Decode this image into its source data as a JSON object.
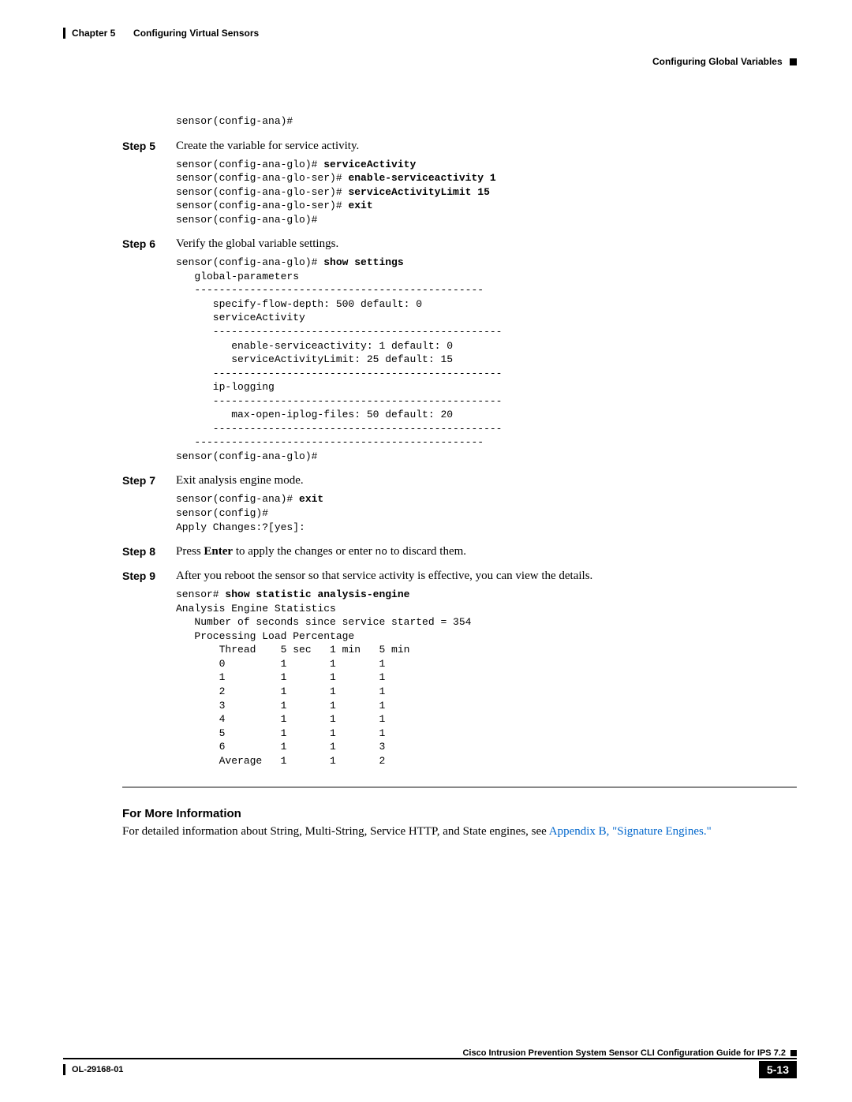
{
  "header": {
    "chapter": "Chapter 5",
    "chapterTitle": "Configuring Virtual Sensors",
    "section": "Configuring Global Variables"
  },
  "preCode0": "sensor(config-ana)#",
  "step5": {
    "label": "Step 5",
    "text": "Create the variable for service activity."
  },
  "code5a": "sensor(config-ana-glo)# ",
  "code5a_bold": "serviceActivity",
  "code5b": "sensor(config-ana-glo-ser)# ",
  "code5b_bold": "enable-serviceactivity 1",
  "code5c": "sensor(config-ana-glo-ser)# ",
  "code5c_bold": "serviceActivityLimit 15",
  "code5d": "sensor(config-ana-glo-ser)# ",
  "code5d_bold": "exit",
  "code5e": "sensor(config-ana-glo)#",
  "step6": {
    "label": "Step 6",
    "text": "Verify the global variable settings."
  },
  "code6a": "sensor(config-ana-glo)# ",
  "code6a_bold": "show settings",
  "code6b": "   global-parameters\n   -----------------------------------------------\n      specify-flow-depth: 500 default: 0\n      serviceActivity\n      -----------------------------------------------\n         enable-serviceactivity: 1 default: 0\n         serviceActivityLimit: 25 default: 15\n      -----------------------------------------------\n      ip-logging\n      -----------------------------------------------\n         max-open-iplog-files: 50 default: 20\n      -----------------------------------------------\n   -----------------------------------------------\nsensor(config-ana-glo)#",
  "step7": {
    "label": "Step 7",
    "text": "Exit analysis engine mode."
  },
  "code7a": "sensor(config-ana)# ",
  "code7a_bold": "exit",
  "code7b": "sensor(config)#\nApply Changes:?[yes]:",
  "step8": {
    "label": "Step 8",
    "textPre": "Press ",
    "textBold": "Enter",
    "textMid": " to apply the changes or enter ",
    "textMono": "no",
    "textPost": " to discard them."
  },
  "step9": {
    "label": "Step 9",
    "text": "After you reboot the sensor so that service activity is effective, you can view the details."
  },
  "code9a": "sensor# ",
  "code9a_bold": "show statistic analysis-engine",
  "code9b": "Analysis Engine Statistics\n   Number of seconds since service started = 354\n   Processing Load Percentage\n       Thread    5 sec   1 min   5 min\n       0         1       1       1\n       1         1       1       1\n       2         1       1       1\n       3         1       1       1\n       4         1       1       1\n       5         1       1       1\n       6         1       1       3\n       Average   1       1       2",
  "fmi": {
    "heading": "For More Information",
    "body": "For detailed information about String, Multi-String, Service HTTP, and State engines, see ",
    "link": "Appendix B, \"Signature Engines.\""
  },
  "footer": {
    "guide": "Cisco Intrusion Prevention System Sensor CLI Configuration Guide for IPS 7.2",
    "docnum": "OL-29168-01",
    "pagenum": "5-13"
  }
}
